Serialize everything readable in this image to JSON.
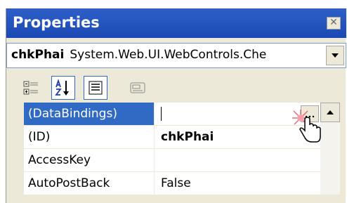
{
  "window": {
    "title": "Properties",
    "close_icon": "close-icon"
  },
  "object_selector": {
    "name": "chkPhai",
    "type": "System.Web.UI.WebControls.Che"
  },
  "toolbar": {
    "buttons": [
      {
        "icon": "categorized-icon",
        "pressed": false
      },
      {
        "icon": "alphabetical-sort-icon",
        "pressed": true
      },
      {
        "icon": "properties-icon",
        "pressed": true
      },
      {
        "icon": "events-icon",
        "pressed": false
      }
    ]
  },
  "grid": {
    "rows": [
      {
        "name": "(DataBindings)",
        "value": "",
        "selected": true
      },
      {
        "name": "(ID)",
        "value": "chkPhai",
        "bold": true
      },
      {
        "name": "AccessKey",
        "value": ""
      },
      {
        "name": "AutoPostBack",
        "value": "False"
      }
    ]
  },
  "colors": {
    "title_bar": "#1b49b4",
    "selection": "#316ac5",
    "panel": "#ece9d8"
  }
}
